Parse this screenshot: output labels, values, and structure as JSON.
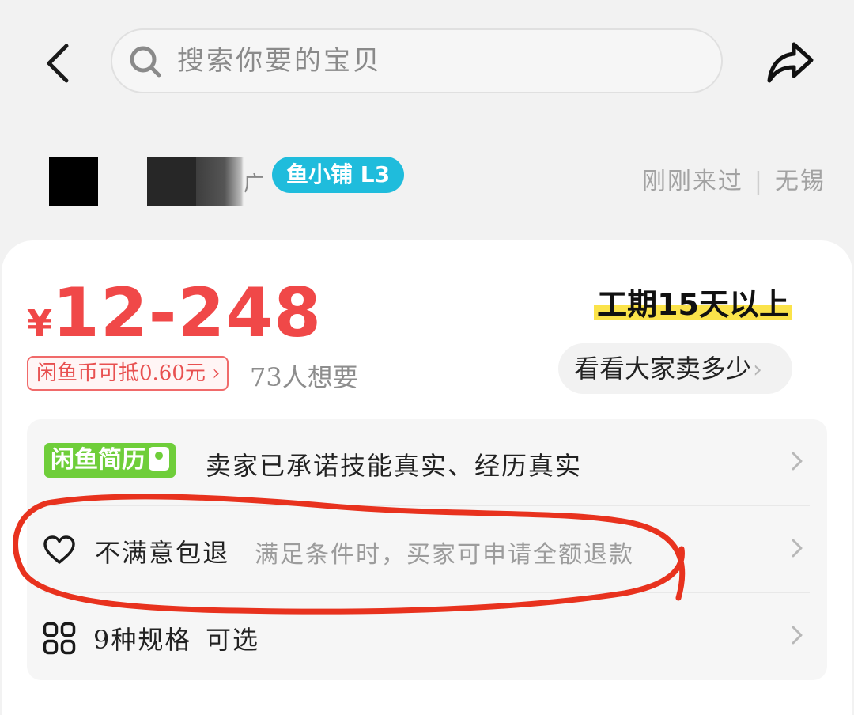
{
  "search": {
    "placeholder": "搜索你要的宝贝"
  },
  "seller": {
    "name_fragment": "广",
    "shop_badge": "鱼小铺 L3",
    "last_seen": "刚刚来过",
    "location": "无锡"
  },
  "product": {
    "currency": "¥",
    "price_range": "12-248",
    "work_period": "工期15天以上",
    "coin_deduct": "闲鱼币可抵0.60元",
    "want_count": "73人想要",
    "compare_button": "看看大家卖多少"
  },
  "info_rows": [
    {
      "badge": "闲鱼简历",
      "text": "卖家已承诺技能真实、经历真实"
    },
    {
      "title": "不满意包退",
      "subtitle": "满足条件时，买家可申请全额退款"
    },
    {
      "title": "9种规格",
      "subtitle": "可选"
    }
  ],
  "colors": {
    "price": "#f04848",
    "shop_badge": "#1fbcdc",
    "resume_badge": "#6fce3a",
    "highlight": "#fbe34a",
    "annotation": "#e8321e"
  }
}
